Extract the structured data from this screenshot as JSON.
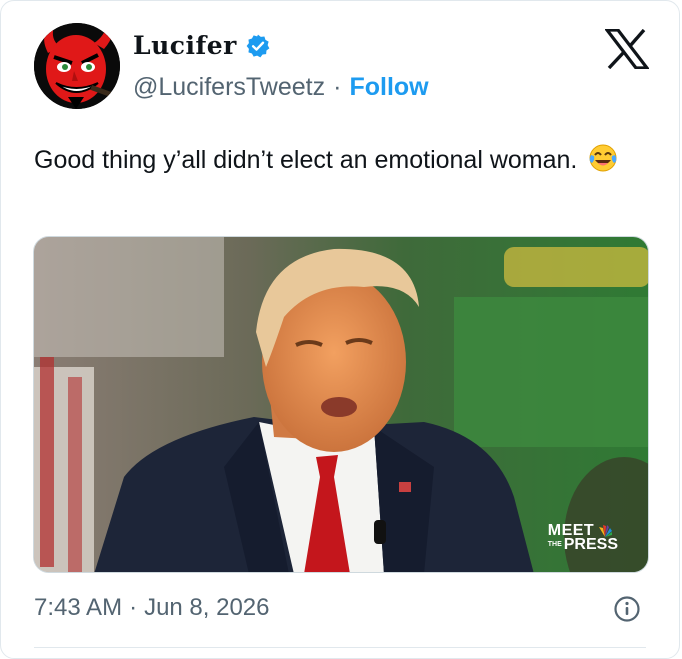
{
  "author": {
    "display_name": "Lucifer",
    "handle": "@LucifersTweetz",
    "separator": "·",
    "follow_label": "Follow",
    "verified": true,
    "avatar_icon": "devil-avatar-icon",
    "verified_color": "#1d9bf0"
  },
  "platform_icon": "x-logo-icon",
  "tweet": {
    "text": "Good thing y’all didn’t elect an emotional woman.",
    "emoji": "face-with-tears-of-joy-icon"
  },
  "media": {
    "watermark_line1": "MEET",
    "watermark_the": "THE",
    "watermark_line2": "PRESS"
  },
  "meta": {
    "time": "7:43 AM",
    "separator": "·",
    "date": "Jun 8, 2026",
    "info_icon": "info-icon"
  },
  "colors": {
    "accent": "#1d9bf0",
    "text_primary": "#0f1419",
    "text_secondary": "#536471",
    "border": "#e1e8ed"
  }
}
